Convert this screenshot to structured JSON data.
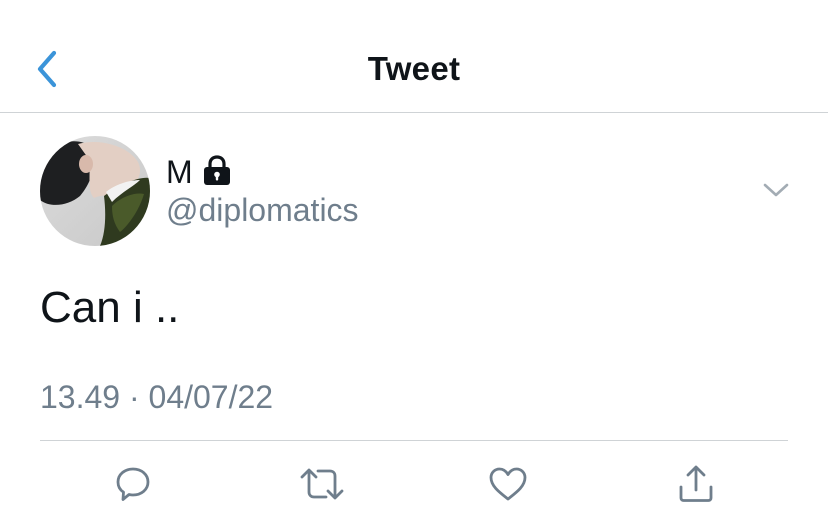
{
  "header": {
    "title": "Tweet",
    "back_icon": "chevron-left-icon"
  },
  "tweet": {
    "author": {
      "display_name": "M",
      "handle": "@diplomatics",
      "protected_icon": "lock-icon"
    },
    "text": "Can i ..",
    "time": "13.49",
    "separator": "·",
    "date": "04/07/22"
  },
  "actions": [
    {
      "name": "reply",
      "icon": "speech-bubble-icon"
    },
    {
      "name": "retweet",
      "icon": "retweet-arrows-icon"
    },
    {
      "name": "like",
      "icon": "heart-icon"
    },
    {
      "name": "share",
      "icon": "share-upload-icon"
    }
  ],
  "colors": {
    "accent": "#1d9bf0",
    "text_primary": "#0f1419",
    "text_secondary": "#6f7e8c",
    "divider": "#cfd3d6"
  }
}
